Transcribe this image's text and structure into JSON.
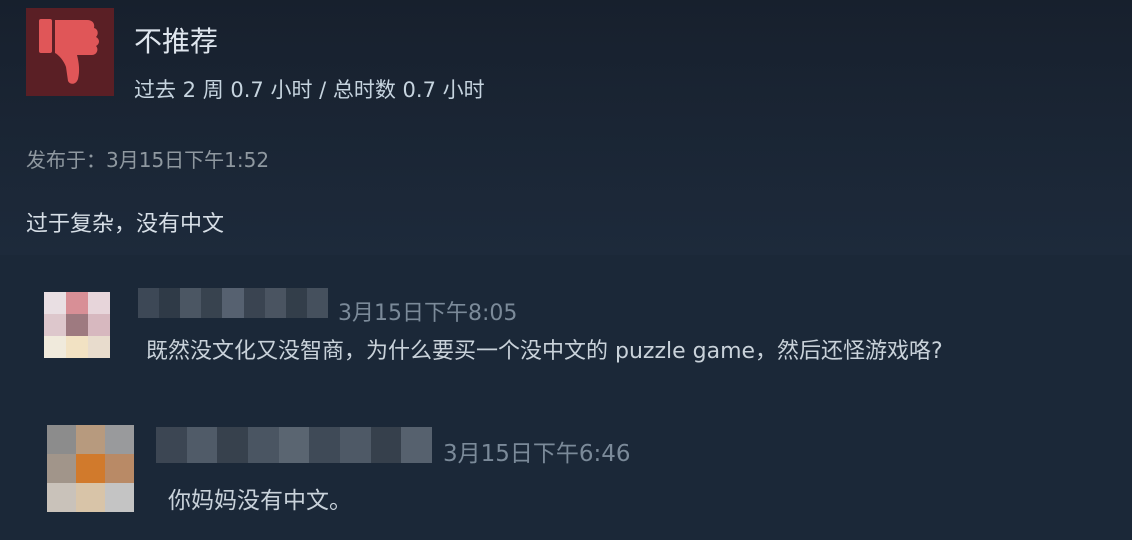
{
  "review": {
    "verdict": "不推荐",
    "hours": "过去 2 周 0.7 小时 / 总时数 0.7 小时",
    "posted": "发布于：3月15日下午1:52",
    "text": "过于复杂，没有中文",
    "icon": "thumbs-down-icon"
  },
  "comments": [
    {
      "time": "3月15日下午8:05",
      "text": "既然没文化又没智商，为什么要买一个没中文的 puzzle game，然后还怪游戏咯?"
    },
    {
      "time": "3月15日下午6:46",
      "text": "你妈妈没有中文。"
    }
  ],
  "colors": {
    "background": "#1b2838",
    "thumb_bg": "#5a1f25",
    "thumb_icon": "#e05658"
  }
}
